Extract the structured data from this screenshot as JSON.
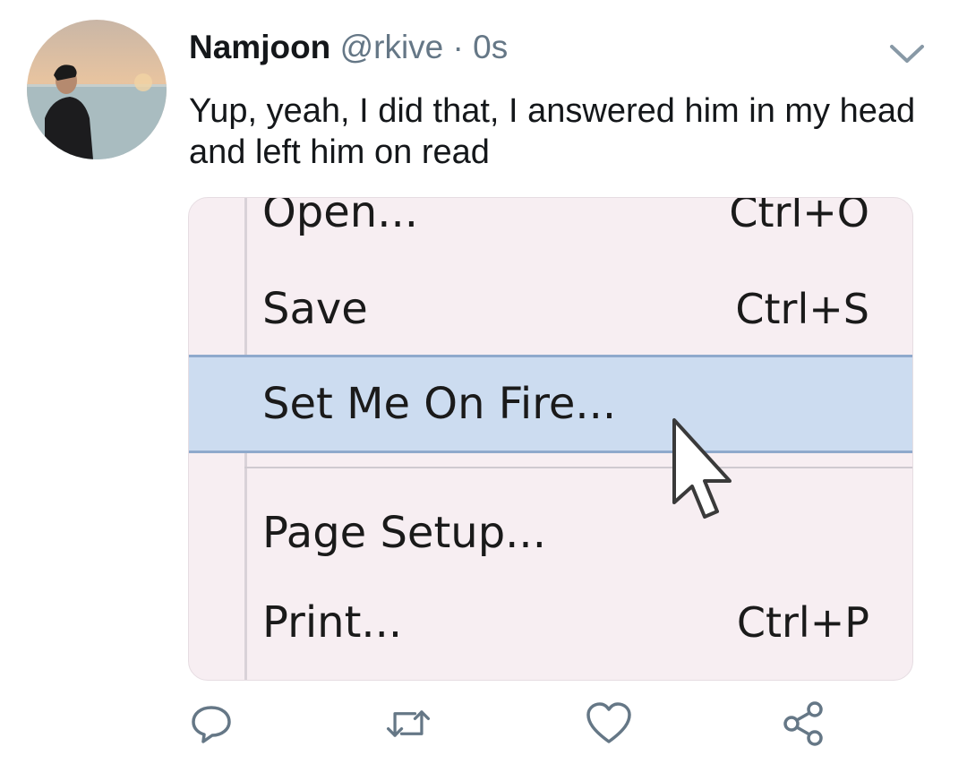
{
  "tweet": {
    "display_name": "Namjoon",
    "handle": "@rkive",
    "separator": "·",
    "timestamp": "0s",
    "text": "Yup, yeah, I did that, I answered him in my head and left him on read"
  },
  "media": {
    "menu_items": [
      {
        "label": "Open...",
        "shortcut": "Ctrl+O"
      },
      {
        "label": "Save",
        "shortcut": "Ctrl+S"
      },
      {
        "label": "Set Me On Fire...",
        "shortcut": "",
        "highlighted": true
      },
      {
        "label": "Page Setup...",
        "shortcut": ""
      },
      {
        "label": "Print...",
        "shortcut": "Ctrl+P"
      }
    ]
  },
  "icons": {
    "menu_chevron": "chevron-down-icon",
    "reply": "reply-icon",
    "retweet": "retweet-icon",
    "like": "heart-icon",
    "share": "share-icon"
  },
  "colors": {
    "text_primary": "#14171a",
    "text_secondary": "#657786",
    "icon_gray": "#657786",
    "menu_highlight": "#ccdcf0"
  }
}
